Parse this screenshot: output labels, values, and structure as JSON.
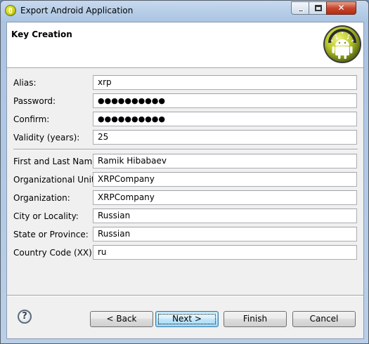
{
  "window": {
    "title": "Export Android Application",
    "minimize_label": "—",
    "maximize_label": "□",
    "close_label": "✕"
  },
  "header": {
    "title": "Key Creation",
    "logo_icon": "android-robot-icon"
  },
  "form": {
    "alias": {
      "label": "Alias:",
      "value": "xrp"
    },
    "password": {
      "label": "Password:",
      "value": "●●●●●●●●●●"
    },
    "confirm": {
      "label": "Confirm:",
      "value": "●●●●●●●●●●"
    },
    "validity": {
      "label": "Validity (years):",
      "value": "25"
    },
    "name": {
      "label": "First and Last Name:",
      "value": "Ramik Hibabaev"
    },
    "unit": {
      "label": "Organizational Unit:",
      "value": "XRPCompany"
    },
    "organization": {
      "label": "Organization:",
      "value": "XRPCompany"
    },
    "city": {
      "label": "City or Locality:",
      "value": "Russian"
    },
    "state": {
      "label": "State or Province:",
      "value": "Russian"
    },
    "country": {
      "label": "Country Code (XX):",
      "value": "ru"
    }
  },
  "buttons": {
    "help": "?",
    "back": "< Back",
    "next": "Next >",
    "finish": "Finish",
    "cancel": "Cancel"
  },
  "colors": {
    "accent_button": "#3c7fb1",
    "android_green": "#a4c639"
  }
}
